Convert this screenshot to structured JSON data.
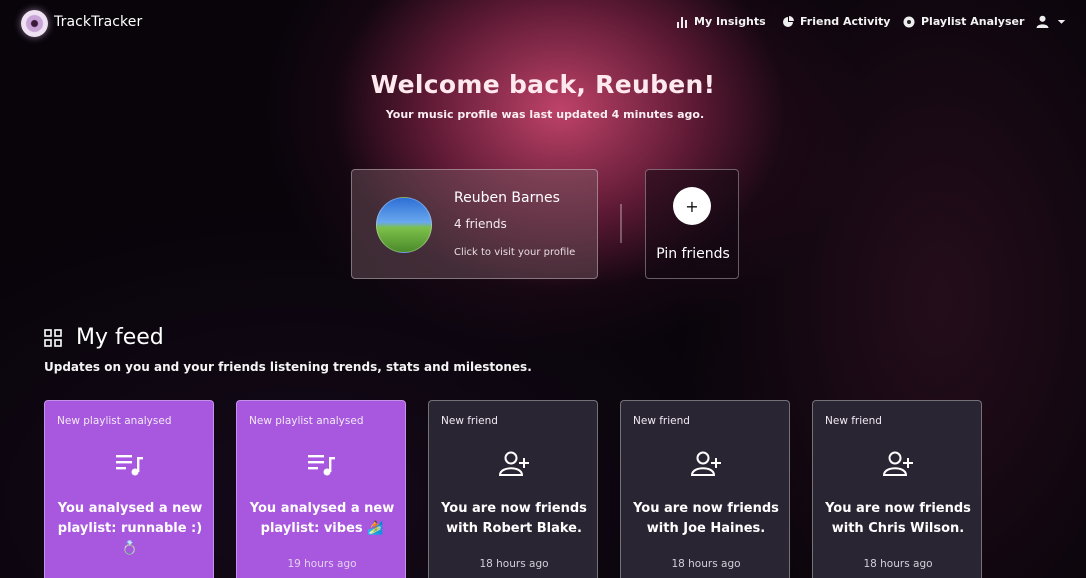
{
  "nav": {
    "brand": "TrackTracker",
    "items": [
      {
        "label": "My Insights",
        "icon": "bar-chart-icon"
      },
      {
        "label": "Friend Activity",
        "icon": "pie-chart-icon"
      },
      {
        "label": "Playlist Analyser",
        "icon": "record-icon"
      }
    ],
    "user_icon": "user-icon"
  },
  "hero": {
    "title": "Welcome back, Reuben!",
    "subtitle": "Your music profile was last updated 4 minutes ago."
  },
  "profile": {
    "name": "Reuben Barnes",
    "friends": "4 friends",
    "visit": "Click to visit your profile"
  },
  "pin": {
    "plus": "+",
    "label": "Pin friends"
  },
  "feed": {
    "title": "My feed",
    "subtitle": "Updates on you and your friends listening trends, stats and milestones.",
    "cards": [
      {
        "type": "New playlist analysed",
        "text": "You analysed a new playlist: runnable :) 💍",
        "time": "",
        "icon": "playlist-icon",
        "theme": "purple"
      },
      {
        "type": "New playlist analysed",
        "text": "You analysed a new playlist: vibes 🏄",
        "time": "19 hours ago",
        "icon": "playlist-icon",
        "theme": "purple"
      },
      {
        "type": "New friend",
        "text": "You are now friends with Robert Blake.",
        "time": "18 hours ago",
        "icon": "add-friend-icon",
        "theme": "dark"
      },
      {
        "type": "New friend",
        "text": "You are now friends with Joe Haines.",
        "time": "18 hours ago",
        "icon": "add-friend-icon",
        "theme": "dark"
      },
      {
        "type": "New friend",
        "text": "You are now friends with Chris Wilson.",
        "time": "18 hours ago",
        "icon": "add-friend-icon",
        "theme": "dark"
      }
    ]
  },
  "colors": {
    "accent_purple": "#a857df",
    "card_dark": "#2a2532",
    "glow": "#c8466e"
  }
}
